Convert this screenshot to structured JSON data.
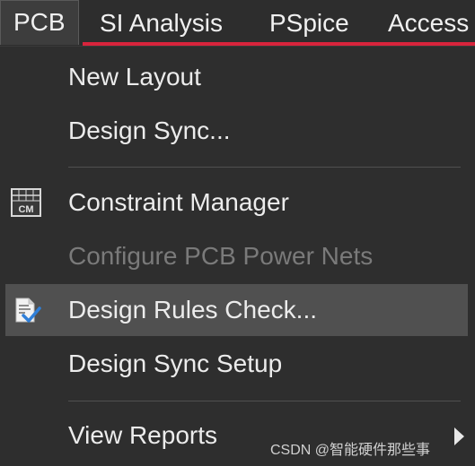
{
  "menubar": {
    "items": [
      {
        "label": "PCB",
        "active": true
      },
      {
        "label": "SI Analysis"
      },
      {
        "label": "PSpice"
      },
      {
        "label": "Access"
      }
    ],
    "accent_color": "#d8243c"
  },
  "dropdown": {
    "items": [
      {
        "label": "New Layout",
        "enabled": true
      },
      {
        "label": "Design Sync...",
        "enabled": true
      },
      {
        "label": "Constraint Manager",
        "enabled": true,
        "icon": "constraint-manager-icon",
        "icon_text": "CM"
      },
      {
        "label": "Configure PCB Power Nets",
        "enabled": false
      },
      {
        "label": "Design Rules Check...",
        "enabled": true,
        "icon": "design-rules-check-icon",
        "highlighted": true
      },
      {
        "label": "Design Sync Setup",
        "enabled": true
      },
      {
        "label": "View Reports",
        "enabled": true,
        "submenu": true,
        "icon": "submenu-arrow-icon"
      }
    ]
  },
  "watermark": "CSDN @智能硬件那些事"
}
